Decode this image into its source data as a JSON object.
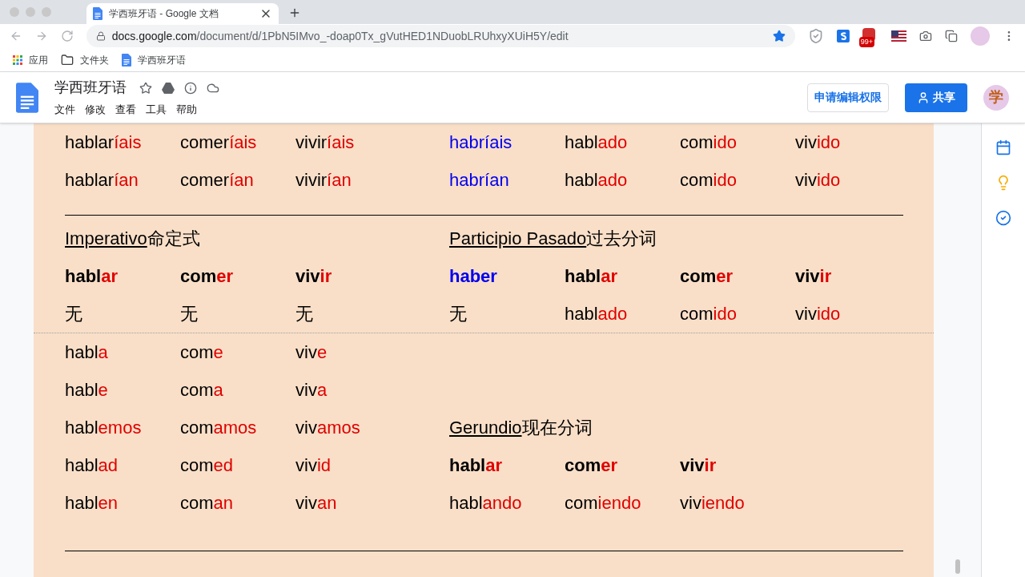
{
  "browser": {
    "tab_title": "学西班牙语 - Google 文档",
    "url_host": "docs.google.com",
    "url_path": "/document/d/1PbN5IMvo_-doap0Tx_gVutHED1NDuobLRUhxyXUiH5Y/edit",
    "extension_badge": "99+",
    "bookmarks": [
      "应用",
      "文件夹",
      "学西班牙语"
    ]
  },
  "docs": {
    "title": "学西班牙语",
    "menu": [
      "文件",
      "修改",
      "查看",
      "工具",
      "帮助"
    ],
    "request_edit": "申请编辑权限",
    "share": "共享",
    "avatar": "学"
  },
  "body": [
    {
      "kind": "row",
      "bold": false,
      "left": {
        "kind": "words",
        "words": [
          {
            "parts": [
              {
                "text": "hablar",
                "kind": "stem"
              },
              {
                "text": "íais",
                "kind": "ending"
              }
            ]
          },
          {
            "parts": [
              {
                "text": "comer",
                "kind": "stem"
              },
              {
                "text": "íais",
                "kind": "ending"
              }
            ]
          },
          {
            "parts": [
              {
                "text": "vivir",
                "kind": "stem"
              },
              {
                "text": "íais",
                "kind": "ending"
              }
            ]
          }
        ]
      },
      "right": {
        "kind": "words",
        "words": [
          {
            "parts": [
              {
                "text": "habríais",
                "kind": "auxiliary"
              }
            ]
          },
          {
            "parts": [
              {
                "text": "habl",
                "kind": "stem"
              },
              {
                "text": "ado",
                "kind": "ending"
              }
            ]
          },
          {
            "parts": [
              {
                "text": "com",
                "kind": "stem"
              },
              {
                "text": "ido",
                "kind": "ending"
              }
            ]
          },
          {
            "parts": [
              {
                "text": "viv",
                "kind": "stem"
              },
              {
                "text": "ido",
                "kind": "ending"
              }
            ]
          }
        ]
      }
    },
    {
      "kind": "row",
      "bold": false,
      "left": {
        "kind": "words",
        "words": [
          {
            "parts": [
              {
                "text": "hablar",
                "kind": "stem"
              },
              {
                "text": "ían",
                "kind": "ending"
              }
            ]
          },
          {
            "parts": [
              {
                "text": "comer",
                "kind": "stem"
              },
              {
                "text": "ían",
                "kind": "ending"
              }
            ]
          },
          {
            "parts": [
              {
                "text": "vivir",
                "kind": "stem"
              },
              {
                "text": "ían",
                "kind": "ending"
              }
            ]
          }
        ]
      },
      "right": {
        "kind": "words",
        "words": [
          {
            "parts": [
              {
                "text": "habrían",
                "kind": "auxiliary"
              }
            ]
          },
          {
            "parts": [
              {
                "text": "habl",
                "kind": "stem"
              },
              {
                "text": "ado",
                "kind": "ending"
              }
            ]
          },
          {
            "parts": [
              {
                "text": "com",
                "kind": "stem"
              },
              {
                "text": "ido",
                "kind": "ending"
              }
            ]
          },
          {
            "parts": [
              {
                "text": "viv",
                "kind": "stem"
              },
              {
                "text": "ido",
                "kind": "ending"
              }
            ]
          }
        ]
      }
    },
    {
      "kind": "rule"
    },
    {
      "kind": "row",
      "left": {
        "kind": "heading",
        "title": "Imperativo",
        "subtitle": "命定式"
      },
      "right": {
        "kind": "heading",
        "title": "Participio Pasado",
        "subtitle": "过去分词"
      }
    },
    {
      "kind": "row",
      "bold": true,
      "left": {
        "kind": "words",
        "words": [
          {
            "parts": [
              {
                "text": "habl",
                "kind": "stem"
              },
              {
                "text": "ar",
                "kind": "ending"
              }
            ]
          },
          {
            "parts": [
              {
                "text": "com",
                "kind": "stem"
              },
              {
                "text": "er",
                "kind": "ending"
              }
            ]
          },
          {
            "parts": [
              {
                "text": "viv",
                "kind": "stem"
              },
              {
                "text": "ir",
                "kind": "ending"
              }
            ]
          }
        ]
      },
      "right": {
        "kind": "words",
        "words": [
          {
            "parts": [
              {
                "text": "haber",
                "kind": "auxiliary"
              }
            ]
          },
          {
            "parts": [
              {
                "text": "habl",
                "kind": "stem"
              },
              {
                "text": "ar",
                "kind": "ending"
              }
            ]
          },
          {
            "parts": [
              {
                "text": "com",
                "kind": "stem"
              },
              {
                "text": "er",
                "kind": "ending"
              }
            ]
          },
          {
            "parts": [
              {
                "text": "viv",
                "kind": "stem"
              },
              {
                "text": "ir",
                "kind": "ending"
              }
            ]
          }
        ]
      }
    },
    {
      "kind": "row",
      "bold": false,
      "left": {
        "kind": "words",
        "words": [
          {
            "parts": [
              {
                "text": "无",
                "kind": "stem"
              }
            ]
          },
          {
            "parts": [
              {
                "text": "无",
                "kind": "stem"
              }
            ]
          },
          {
            "parts": [
              {
                "text": "无",
                "kind": "stem"
              }
            ]
          }
        ]
      },
      "right": {
        "kind": "words",
        "words": [
          {
            "parts": [
              {
                "text": "无",
                "kind": "stem"
              }
            ]
          },
          {
            "parts": [
              {
                "text": "habl",
                "kind": "stem"
              },
              {
                "text": "ado",
                "kind": "ending"
              }
            ]
          },
          {
            "parts": [
              {
                "text": "com",
                "kind": "stem"
              },
              {
                "text": "ido",
                "kind": "ending"
              }
            ]
          },
          {
            "parts": [
              {
                "text": "viv",
                "kind": "stem"
              },
              {
                "text": "ido",
                "kind": "ending"
              }
            ]
          }
        ]
      }
    },
    {
      "kind": "dotted_rule"
    },
    {
      "kind": "row",
      "bold": false,
      "left": {
        "kind": "words",
        "words": [
          {
            "parts": [
              {
                "text": "habl",
                "kind": "stem"
              },
              {
                "text": "a",
                "kind": "ending"
              }
            ]
          },
          {
            "parts": [
              {
                "text": "com",
                "kind": "stem"
              },
              {
                "text": "e",
                "kind": "ending"
              }
            ]
          },
          {
            "parts": [
              {
                "text": "viv",
                "kind": "stem"
              },
              {
                "text": "e",
                "kind": "ending"
              }
            ]
          }
        ]
      }
    },
    {
      "kind": "row",
      "bold": false,
      "left": {
        "kind": "words",
        "words": [
          {
            "parts": [
              {
                "text": "habl",
                "kind": "stem"
              },
              {
                "text": "e",
                "kind": "ending"
              }
            ]
          },
          {
            "parts": [
              {
                "text": "com",
                "kind": "stem"
              },
              {
                "text": "a",
                "kind": "ending"
              }
            ]
          },
          {
            "parts": [
              {
                "text": "viv",
                "kind": "stem"
              },
              {
                "text": "a",
                "kind": "ending"
              }
            ]
          }
        ]
      }
    },
    {
      "kind": "row",
      "bold": false,
      "left": {
        "kind": "words",
        "words": [
          {
            "parts": [
              {
                "text": "habl",
                "kind": "stem"
              },
              {
                "text": "emos",
                "kind": "ending"
              }
            ]
          },
          {
            "parts": [
              {
                "text": "com",
                "kind": "stem"
              },
              {
                "text": "amos",
                "kind": "ending"
              }
            ]
          },
          {
            "parts": [
              {
                "text": "viv",
                "kind": "stem"
              },
              {
                "text": "amos",
                "kind": "ending"
              }
            ]
          }
        ]
      },
      "right": {
        "kind": "heading",
        "title": "Gerundio",
        "subtitle": "现在分词"
      }
    },
    {
      "kind": "row",
      "bold": false,
      "left": {
        "kind": "words",
        "words": [
          {
            "parts": [
              {
                "text": "habl",
                "kind": "stem"
              },
              {
                "text": "ad",
                "kind": "ending"
              }
            ]
          },
          {
            "parts": [
              {
                "text": "com",
                "kind": "stem"
              },
              {
                "text": "ed",
                "kind": "ending"
              }
            ]
          },
          {
            "parts": [
              {
                "text": "viv",
                "kind": "stem"
              },
              {
                "text": "id",
                "kind": "ending"
              }
            ]
          }
        ]
      },
      "right": {
        "kind": "words",
        "bold": true,
        "words": [
          {
            "parts": [
              {
                "text": "habl",
                "kind": "stem"
              },
              {
                "text": "ar",
                "kind": "ending"
              }
            ]
          },
          {
            "parts": [
              {
                "text": "com",
                "kind": "stem"
              },
              {
                "text": "er",
                "kind": "ending"
              }
            ]
          },
          {
            "parts": [
              {
                "text": "viv",
                "kind": "stem"
              },
              {
                "text": "ir",
                "kind": "ending"
              }
            ]
          }
        ]
      }
    },
    {
      "kind": "row",
      "bold": false,
      "left": {
        "kind": "words",
        "words": [
          {
            "parts": [
              {
                "text": "habl",
                "kind": "stem"
              },
              {
                "text": "en",
                "kind": "ending"
              }
            ]
          },
          {
            "parts": [
              {
                "text": "com",
                "kind": "stem"
              },
              {
                "text": "an",
                "kind": "ending"
              }
            ]
          },
          {
            "parts": [
              {
                "text": "viv",
                "kind": "stem"
              },
              {
                "text": "an",
                "kind": "ending"
              }
            ]
          }
        ]
      },
      "right": {
        "kind": "words",
        "words": [
          {
            "parts": [
              {
                "text": "habl",
                "kind": "stem"
              },
              {
                "text": "ando",
                "kind": "ending"
              }
            ]
          },
          {
            "parts": [
              {
                "text": "com",
                "kind": "stem"
              },
              {
                "text": "iendo",
                "kind": "ending"
              }
            ]
          },
          {
            "parts": [
              {
                "text": "viv",
                "kind": "stem"
              },
              {
                "text": "iendo",
                "kind": "ending"
              }
            ]
          }
        ]
      }
    },
    {
      "kind": "rule"
    }
  ]
}
